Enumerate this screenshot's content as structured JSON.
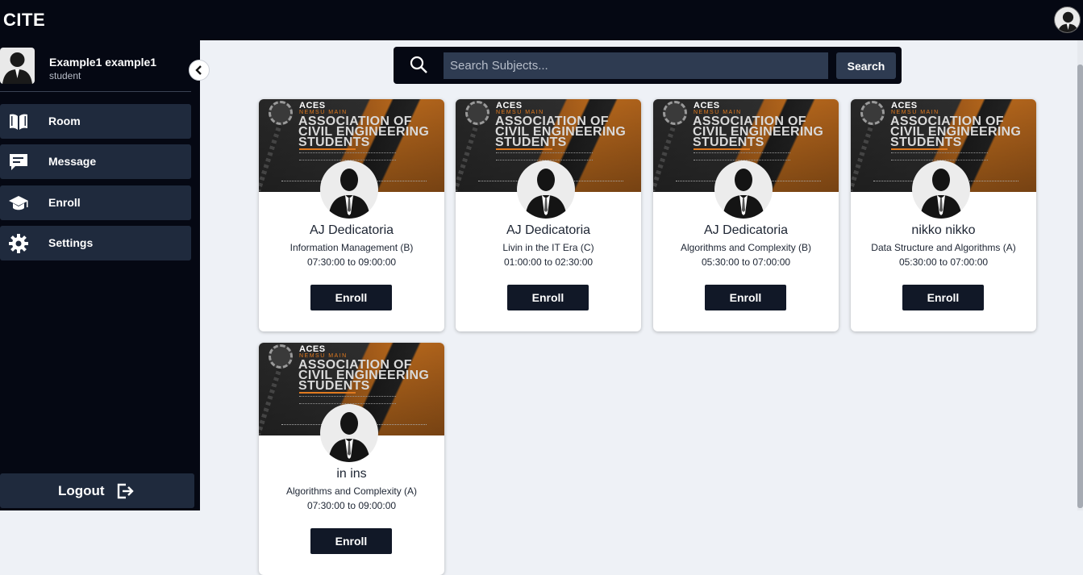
{
  "app": {
    "title": "CITE"
  },
  "user": {
    "name": "Example1 example1",
    "role": "student"
  },
  "sidebar": {
    "items": [
      {
        "label": "Room",
        "icon": "book-icon"
      },
      {
        "label": "Message",
        "icon": "message-icon"
      },
      {
        "label": "Enroll",
        "icon": "graduation-cap-icon"
      },
      {
        "label": "Settings",
        "icon": "gear-icon"
      }
    ],
    "logout_label": "Logout"
  },
  "search": {
    "placeholder": "Search Subjects...",
    "button_label": "Search"
  },
  "banner": {
    "org": "ACES",
    "campus": "NEMSU MAIN",
    "title": "ASSOCIATION OF CIVIL ENGINEERING STUDENTS"
  },
  "cards": [
    {
      "name": "AJ Dedicatoria",
      "subject": "Information Management (B)",
      "time": "07:30:00 to 09:00:00",
      "button": "Enroll"
    },
    {
      "name": "AJ Dedicatoria",
      "subject": "Livin in the IT Era (C)",
      "time": "01:00:00 to 02:30:00",
      "button": "Enroll"
    },
    {
      "name": "AJ Dedicatoria",
      "subject": "Algorithms and Complexity (B)",
      "time": "05:30:00 to 07:00:00",
      "button": "Enroll"
    },
    {
      "name": "nikko nikko",
      "subject": "Data Structure and Algorithms (A)",
      "time": "05:30:00 to 07:00:00",
      "button": "Enroll"
    },
    {
      "name": "in ins",
      "subject": "Algorithms and Complexity (A)",
      "time": "07:30:00 to 09:00:00",
      "button": "Enroll"
    }
  ],
  "colors": {
    "topbar": "#050813",
    "nav_item": "#1f2a3d",
    "button": "#111827",
    "background": "#eef1f6"
  }
}
